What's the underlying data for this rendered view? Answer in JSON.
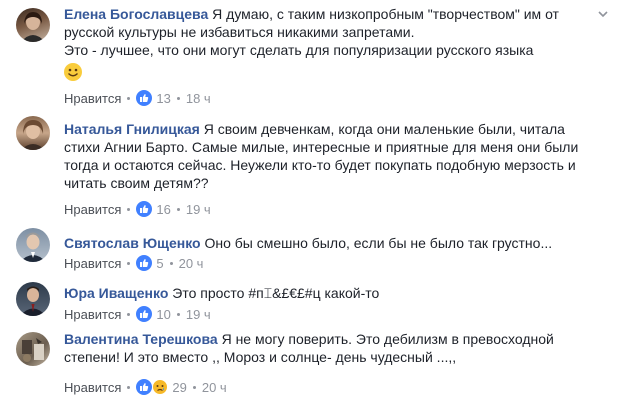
{
  "comments": [
    {
      "author": "Елена Богославцева",
      "text": "Я думаю, с таким низкопробным \"творчеством\" им от русской культуры не избавиться никакими запретами.",
      "text2": "Это - лучшее, что они могут сделать для популяризации русского языка",
      "emoji": "smile-emoji",
      "like_label": "Нравится",
      "likes": "13",
      "time": "18 ч"
    },
    {
      "author": "Наталья Гнилицкая",
      "text": "Я своим девченкам, когда они маленькие были, читала стихи Агнии Барто. Самые милые, интересные и приятные для меня они были тогда и остаются сейчас. Неужели кто-то будет покупать подобную мерзость и читать своим детям??",
      "like_label": "Нравится",
      "likes": "16",
      "time": "19 ч"
    },
    {
      "author": "Святослав Ющенко",
      "text": "Оно бы смешно было, если бы не было так грустно...",
      "like_label": "Нравится",
      "likes": "5",
      "time": "20 ч"
    },
    {
      "author": "Юра Иващенко",
      "text": "Это просто #п⌶&£€£#ц какой-то",
      "like_label": "Нравится",
      "likes": "10",
      "time": "19 ч"
    },
    {
      "author": "Валентина Терешкова",
      "text": "Я не могу поверить. Это дебилизм в превосходной степени! И это вместо ,, Мороз и солнце- день чудесный ...,,",
      "like_label": "Нравится",
      "likes": "29",
      "time": "20 ч"
    }
  ],
  "colors": {
    "author": "#365899",
    "like_blue": "#4080ff",
    "meta_gray": "#90949c"
  }
}
